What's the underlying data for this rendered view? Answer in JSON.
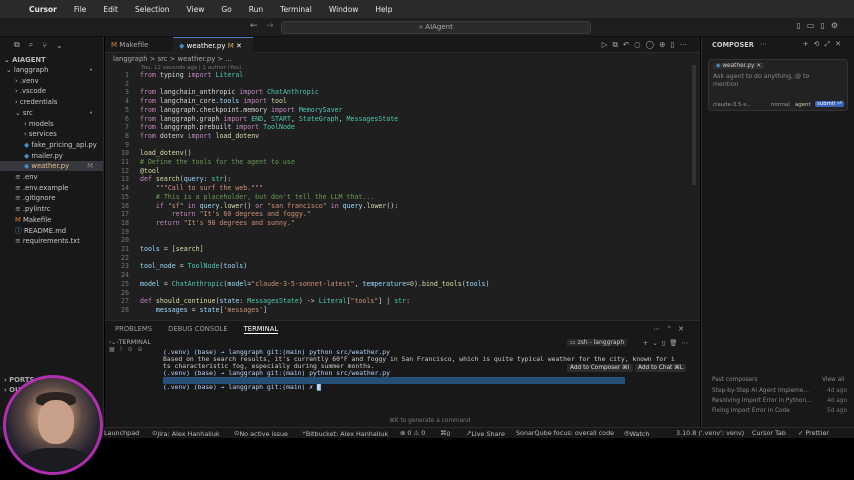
{
  "menubar": {
    "apple": "",
    "app": "Cursor",
    "items": [
      "File",
      "Edit",
      "Selection",
      "View",
      "Go",
      "Run",
      "Terminal",
      "Window",
      "Help"
    ]
  },
  "titlebar": {
    "search": "AIAgent"
  },
  "sidebar": {
    "root": "AIAGENT",
    "rows": [
      {
        "label": "langgraph",
        "kind": "folder-open",
        "indent": 0,
        "badge": "•"
      },
      {
        "label": ".venv",
        "kind": "folder",
        "indent": 1,
        "badge": ""
      },
      {
        "label": ".vscode",
        "kind": "folder",
        "indent": 1,
        "badge": ""
      },
      {
        "label": "credentials",
        "kind": "folder",
        "indent": 1,
        "badge": ""
      },
      {
        "label": "src",
        "kind": "folder-open",
        "indent": 1,
        "badge": "•"
      },
      {
        "label": "models",
        "kind": "folder",
        "indent": 2,
        "badge": ""
      },
      {
        "label": "services",
        "kind": "folder",
        "indent": 2,
        "badge": ""
      },
      {
        "label": "fake_pricing_api.py",
        "kind": "py",
        "indent": 2,
        "badge": ""
      },
      {
        "label": "mailer.py",
        "kind": "py",
        "indent": 2,
        "badge": ""
      },
      {
        "label": "weather.py",
        "kind": "py",
        "indent": 2,
        "badge": "M"
      },
      {
        "label": ".env",
        "kind": "file",
        "indent": 1,
        "badge": ""
      },
      {
        "label": ".env.example",
        "kind": "file",
        "indent": 1,
        "badge": ""
      },
      {
        "label": ".gitignore",
        "kind": "file",
        "indent": 1,
        "badge": ""
      },
      {
        "label": ".pylintrc",
        "kind": "file",
        "indent": 1,
        "badge": ""
      },
      {
        "label": "Makefile",
        "kind": "make",
        "indent": 1,
        "badge": ""
      },
      {
        "label": "README.md",
        "kind": "md",
        "indent": 1,
        "badge": ""
      },
      {
        "label": "requirements.txt",
        "kind": "file",
        "indent": 1,
        "badge": ""
      }
    ],
    "ports": "PORTS",
    "outline": "OU"
  },
  "tabs": [
    {
      "label": "Makefile",
      "active": false
    },
    {
      "label": "weather.py",
      "suffix": "M",
      "active": true
    }
  ],
  "breadcrumb": "langgraph > src > weather.py > ...",
  "blame": "You, 12 seconds ago | 1 author (You)",
  "code": [
    {
      "n": "1",
      "t": "from typing import Literal"
    },
    {
      "n": "2",
      "t": ""
    },
    {
      "n": "3",
      "t": "from langchain_anthropic import ChatAnthropic"
    },
    {
      "n": "4",
      "t": "from langchain_core.tools import tool"
    },
    {
      "n": "5",
      "t": "from langgraph.checkpoint.memory import MemorySaver"
    },
    {
      "n": "6",
      "t": "from langgraph.graph import END, START, StateGraph, MessagesState"
    },
    {
      "n": "7",
      "t": "from langgraph.prebuilt import ToolNode"
    },
    {
      "n": "8",
      "t": "from dotenv import load_dotenv"
    },
    {
      "n": "9",
      "t": ""
    },
    {
      "n": "10",
      "t": "load_dotenv()"
    },
    {
      "n": "11",
      "t": "# Define the tools for the agent to use"
    },
    {
      "n": "12",
      "t": "@tool"
    },
    {
      "n": "13",
      "t": "def search(query: str):"
    },
    {
      "n": "14",
      "t": "    \"\"\"Call to surf the web.\"\"\""
    },
    {
      "n": "15",
      "t": "    # This is a placeholder, but don't tell the LLM that..."
    },
    {
      "n": "16",
      "t": "    if \"sf\" in query.lower() or \"san francisco\" in query.lower():"
    },
    {
      "n": "17",
      "t": "        return \"It's 60 degrees and foggy.\""
    },
    {
      "n": "18",
      "t": "    return \"It's 90 degrees and sunny.\""
    },
    {
      "n": "19",
      "t": ""
    },
    {
      "n": "20",
      "t": ""
    },
    {
      "n": "21",
      "t": "tools = [search]"
    },
    {
      "n": "22",
      "t": ""
    },
    {
      "n": "23",
      "t": "tool_node = ToolNode(tools)"
    },
    {
      "n": "24",
      "t": ""
    },
    {
      "n": "25",
      "t": "model = ChatAnthropic(model=\"claude-3-5-sonnet-latest\", temperature=0).bind_tools(tools)"
    },
    {
      "n": "26",
      "t": ""
    },
    {
      "n": "27",
      "t": "def should_continue(state: MessagesState) -> Literal[\"tools\"] | str:"
    },
    {
      "n": "28",
      "t": "    messages = state['messages']"
    }
  ],
  "panel": {
    "tabs": [
      "PROBLEMS",
      "DEBUG CONSOLE",
      "TERMINAL"
    ],
    "active_tab": "TERMINAL",
    "terminal_label": "TERMINAL",
    "shell": "zsh - langgraph",
    "lines": [
      "(.venv) (base) → langgraph git:(main) python src/weather.py",
      "Based on the search results, it's currently 60°F and foggy in San Francisco, which is quite typical weather for the city, known for i",
      "ts characteristic fog, especially during summer months.",
      "(.venv) (base) → langgraph git:(main) python src/weather.py",
      "Based on the search results, it's currently 90 degrees Fahrenheit and sunny in New York.",
      "(.venv) (base) → langgraph git:(main) ✗ █"
    ],
    "add_composer": "Add to Composer ⌘I",
    "add_chat": "Add to Chat ⌘L",
    "hint": "⌘K to generate a command"
  },
  "composer": {
    "title": "COMPOSER",
    "file_chip": "weather.py",
    "placeholder": "Ask agent to do anything, @ to mention",
    "model": "claude-3.5-s...",
    "mode_normal": "normal",
    "mode_agent": "agent",
    "submit": "submit ⏎",
    "past_label": "Past composers",
    "view_all": "View all",
    "past": [
      {
        "title": "Step-by-Step AI Agent Impleme...",
        "age": "4d ago"
      },
      {
        "title": "Resolving Import Error in Python...",
        "age": "4d ago"
      },
      {
        "title": "Fixing Import Error in Code",
        "age": "5d ago"
      }
    ]
  },
  "statusbar": {
    "launchpad": "Launchpad",
    "jira": "Jira: Alex Hanhaliuk",
    "issue": "No active issue",
    "bitbucket": "Bitbucket: Alex Hanhaliuk",
    "problems": "⊗ 0 ⚠ 0",
    "ports": "0",
    "share": "Live Share",
    "sonar": "SonarQube focus: overall code",
    "watch": "Watch",
    "python": "3.10.8 ('.venv': venv)",
    "cursortab": "Cursor Tab",
    "prettier": "✓ Prettier"
  },
  "colors": {
    "accent": "#4d78cc",
    "keyword": "#c586c0",
    "string": "#ce9178",
    "comment": "#6a9955",
    "highlight": "#264f78",
    "webcam_ring": "#b02fb0"
  }
}
